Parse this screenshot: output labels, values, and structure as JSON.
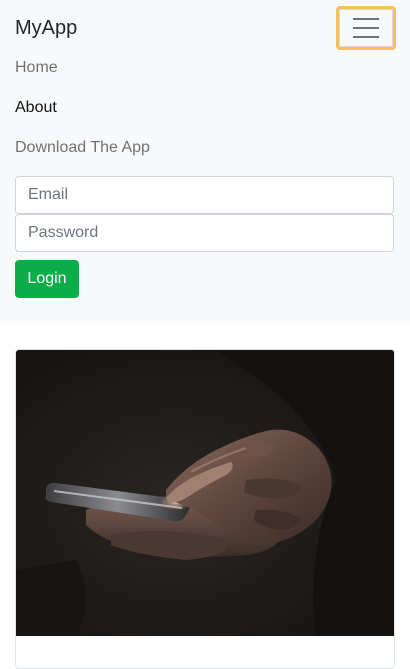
{
  "navbar": {
    "brand": "MyApp",
    "toggler_icon": "hamburger-menu-icon",
    "links": [
      {
        "label": "Home",
        "active": false
      },
      {
        "label": "About",
        "active": true
      },
      {
        "label": "Download The App",
        "active": false
      }
    ]
  },
  "login_form": {
    "email_placeholder": "Email",
    "password_placeholder": "Password",
    "submit_label": "Login"
  },
  "hero": {
    "image_subject": "hands holding a smartphone in the dark"
  },
  "colors": {
    "navbar_bg": "#f8f9fa",
    "focus_ring": "#f6c15c",
    "login_button": "#0aad48"
  }
}
